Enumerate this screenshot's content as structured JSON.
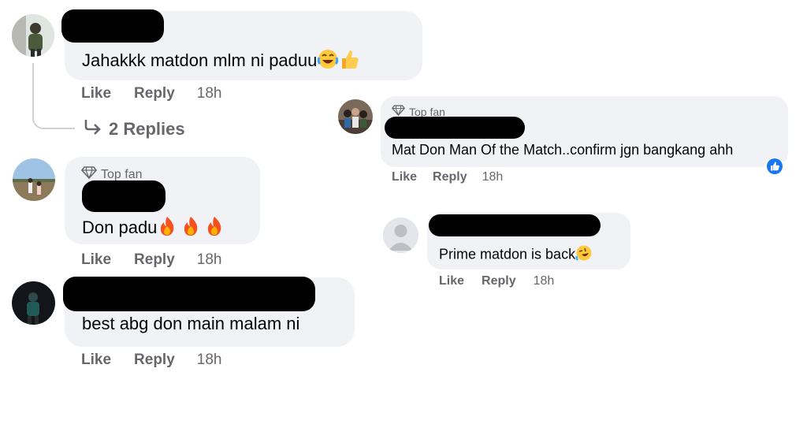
{
  "comments": [
    {
      "text": "Jahakkk matdon mlm ni paduu",
      "emojis": [
        "face-with-tears-of-joy",
        "thumbs-up"
      ],
      "actions": {
        "like": "Like",
        "reply": "Reply",
        "time": "18h"
      },
      "replies_link": "2 Replies"
    },
    {
      "badge": "Top fan",
      "text": "Don padu",
      "emojis": [
        "fire",
        "fire",
        "fire"
      ],
      "actions": {
        "like": "Like",
        "reply": "Reply",
        "time": "18h"
      }
    },
    {
      "text": "best abg don main malam ni",
      "actions": {
        "like": "Like",
        "reply": "Reply",
        "time": "18h"
      }
    },
    {
      "badge": "Top fan",
      "text": "Mat Don Man Of the Match..confirm jgn bangkang ahh",
      "reaction": "like-reaction",
      "actions": {
        "like": "Like",
        "reply": "Reply",
        "time": "18h"
      }
    },
    {
      "text": "Prime matdon is back",
      "emojis": [
        "rolling-on-floor-laughing"
      ],
      "actions": {
        "like": "Like",
        "reply": "Reply",
        "time": "18h"
      }
    }
  ],
  "colors": {
    "bubble": "#f0f2f5",
    "muted_text": "#65676b",
    "like_blue": "#1877f2",
    "redaction": "#000000"
  }
}
